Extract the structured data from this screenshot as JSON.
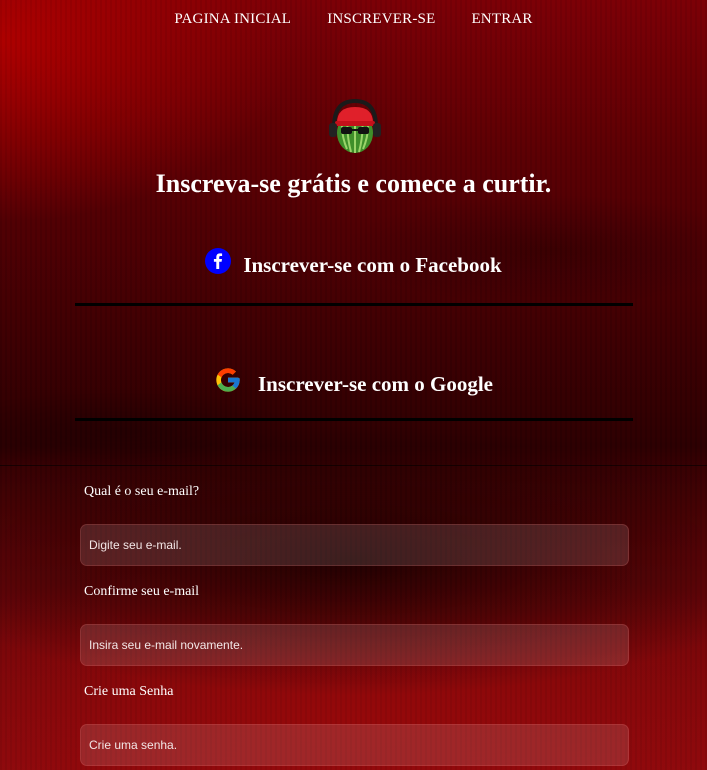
{
  "nav": {
    "items": [
      {
        "label": "PAGINA INICIAL"
      },
      {
        "label": "INSCREVER-SE"
      },
      {
        "label": "ENTRAR"
      }
    ]
  },
  "logo": {
    "icon": "watermelon-headphones-mascot-icon"
  },
  "headline": "Inscreva-se grátis e comece a curtir.",
  "social": {
    "facebook": {
      "label": "Inscrever-se com o Facebook",
      "icon": "facebook-icon",
      "color": "#0000ff"
    },
    "google": {
      "label": "Inscrever-se com o Google",
      "icon": "google-icon"
    }
  },
  "form": {
    "email": {
      "label": "Qual é o seu e-mail?",
      "placeholder": "Digite seu e-mail.",
      "value": ""
    },
    "confirm_email": {
      "label": "Confirme seu e-mail",
      "placeholder": "Insira seu e-mail novamente.",
      "value": ""
    },
    "password": {
      "label": "Crie uma Senha",
      "placeholder": "Crie uma senha.",
      "value": ""
    }
  },
  "colors": {
    "background_red": "#7a0006",
    "divider": "#000000",
    "text": "#ffffff"
  }
}
